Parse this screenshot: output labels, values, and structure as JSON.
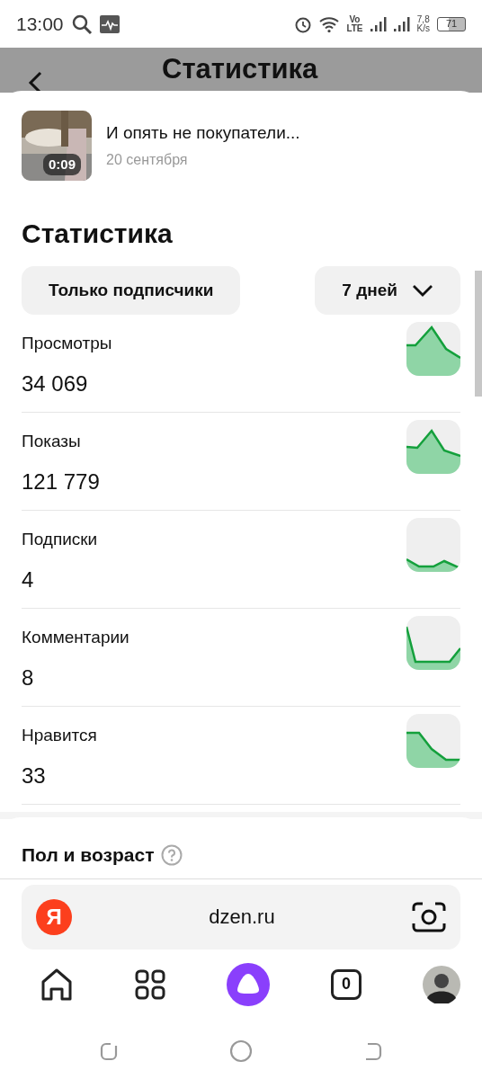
{
  "status_bar": {
    "time": "13:00",
    "network_speed": "7,8",
    "network_speed_unit": "K/s",
    "battery": "71",
    "volte": "Vo",
    "lte": "LTE"
  },
  "header": {
    "title": "Статистика"
  },
  "video": {
    "title": "И опять не покупатели...",
    "date": "20 сентября",
    "duration": "0:09"
  },
  "section_title": "Статистика",
  "filters": [
    {
      "label": "Только подписчики",
      "kind": "toggle"
    },
    {
      "label": "7 дней",
      "kind": "dropdown"
    }
  ],
  "metrics": [
    {
      "name": "Просмотры",
      "value": "34 069"
    },
    {
      "name": "Показы",
      "value": "121 779"
    },
    {
      "name": "Подписки",
      "value": "4"
    },
    {
      "name": "Комментарии",
      "value": "8"
    },
    {
      "name": "Нравится",
      "value": "33"
    }
  ],
  "demographics": {
    "title": "Пол и возраст"
  },
  "address_bar": {
    "url": "dzen.ru",
    "logo": "Я"
  },
  "bottom_nav": {
    "tabs_count": "0"
  }
}
